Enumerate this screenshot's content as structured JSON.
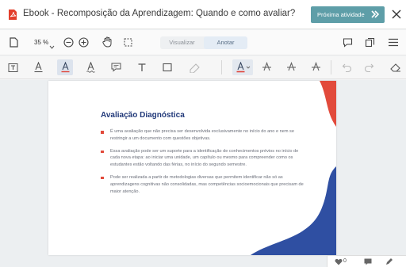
{
  "header": {
    "title": "Ebook - Recomposição da Aprendizagem: Quando e como avaliar?",
    "next_button": "Próxima atividade",
    "icons": [
      "pdf-icon",
      "double-chevron-right-icon",
      "close-icon"
    ]
  },
  "toolbar": {
    "zoom": "35 %",
    "modes": {
      "view": "Visualizar",
      "annotate": "Anotar",
      "active": "Anotar"
    },
    "icons": [
      "file-icon",
      "zoom-out-icon",
      "zoom-in-icon",
      "pan-hand-icon",
      "select-area-icon",
      "comment-icon",
      "thumbnails-icon",
      "menu-icon"
    ]
  },
  "annotation_tools": {
    "icons": [
      "text-select-icon",
      "underline-icon",
      "highlight-icon",
      "squiggly-icon",
      "note-icon",
      "text-icon",
      "rectangle-icon",
      "eraser-pen-icon",
      "font-color-icon",
      "strikethrough-icon",
      "strikethrough-alt-icon",
      "strikethrough-alt2-icon",
      "undo-icon",
      "redo-icon",
      "eraser-icon"
    ],
    "highlight_color": "#e0453b"
  },
  "page": {
    "title": "Avaliação Diagnóstica",
    "bullets": [
      "É uma avaliação que não precisa ser desenvolvida exclusivamente no início do ano e nem se restringir a um documento com questões objetivas.",
      "Essa avaliação pode ser um suporte para a identificação de conhecimentos prévios no início de cada nova etapa: ao iniciar uma unidade, um capítulo ou mesmo para compreender como os estudantes estão voltando das férias, no início do segundo semestre.",
      "Pode ser realizada a partir de metodologias diversas que permitem identificar não só as aprendizagens cognitivas não consolidadas, mas competências socioemocionais que precisam de maior atenção."
    ],
    "colors": {
      "title": "#223a7a",
      "accent_red": "#e24a3b",
      "accent_blue": "#2f4fa2"
    }
  },
  "footer": {
    "likes": "0",
    "icons": [
      "heart-icon",
      "comment-icon",
      "edit-icon"
    ]
  }
}
